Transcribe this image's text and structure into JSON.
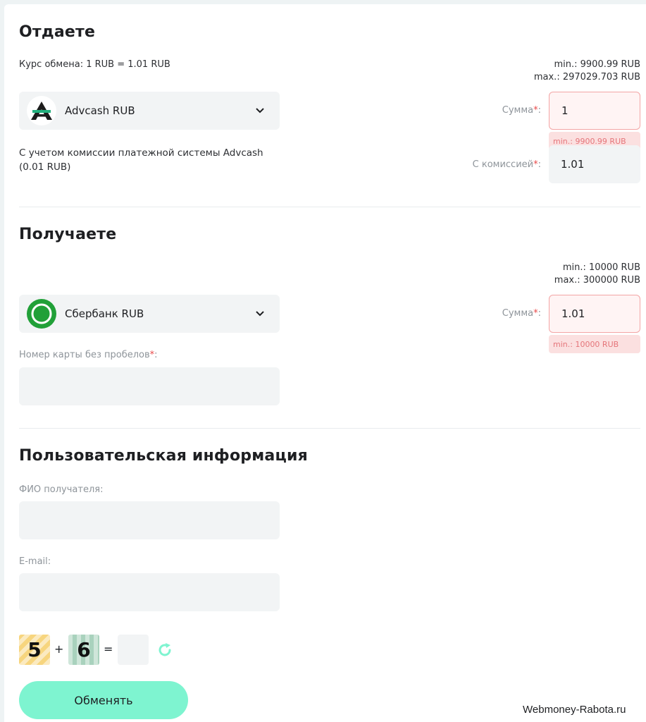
{
  "give": {
    "title": "Отдаете",
    "rate": "Курс обмена: 1 RUB = 1.01 RUB",
    "min": "min.: 9900.99 RUB",
    "max": "max.: 297029.703 RUB",
    "currency": "Advcash RUB",
    "sum_label": "Сумма",
    "sum_value": "1",
    "sum_error": "min.: 9900.99 RUB",
    "commission_note": "С учетом комиссии платежной системы Advcash (0.01 RUB)",
    "commission_label": "С комиссией",
    "commission_value": "1.01"
  },
  "receive": {
    "title": "Получаете",
    "min": "min.: 10000 RUB",
    "max": "max.: 300000 RUB",
    "currency": "Сбербанк RUB",
    "sum_label": "Сумма",
    "sum_value": "1.01",
    "sum_error": "min.: 10000 RUB",
    "card_label": "Номер карты без пробелов",
    "card_value": ""
  },
  "user_info": {
    "title": "Пользовательская информация",
    "fio_label": "ФИО получателя:",
    "fio_value": "",
    "email_label": "E-mail:",
    "email_value": ""
  },
  "captcha": {
    "a": "5",
    "op": "+",
    "b": "6",
    "eq": "=",
    "answer": ""
  },
  "submit_label": "Обменять",
  "required_mark": "*",
  "colon": ":",
  "watermark": "Webmoney-Rabota.ru",
  "colors": {
    "accent": "#7ef4d0",
    "error_bg": "#fbe0e0",
    "error_text": "#e5757a",
    "required": "#e84b4b"
  },
  "icons": {
    "advcash": "advcash-logo-icon",
    "sberbank": "sberbank-logo-icon",
    "chevron": "chevron-down-icon",
    "refresh": "refresh-icon"
  }
}
